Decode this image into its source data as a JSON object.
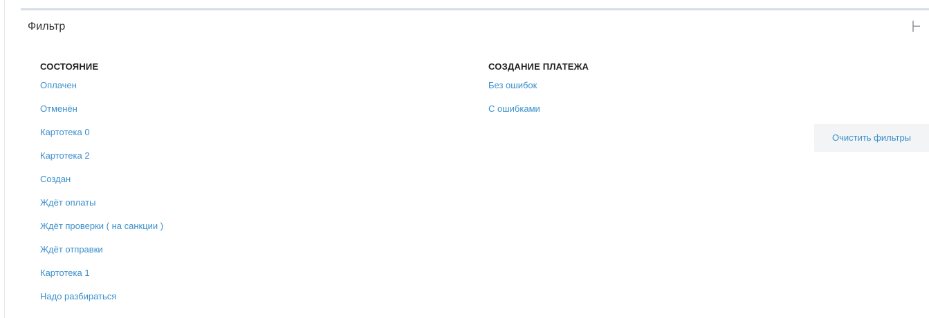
{
  "panel": {
    "title": "Фильтр",
    "collapse_icon": "collapse-bar-icon"
  },
  "groups": [
    {
      "title": "СОСТОЯНИЕ",
      "items": [
        "Оплачен",
        "Отменён",
        "Картотека 0",
        "Картотека 2",
        "Создан",
        "Ждёт оплаты",
        "Ждёт проверки ( на санкции )",
        "Ждёт отправки",
        "Картотека 1",
        "Надо разбираться"
      ]
    },
    {
      "title": "СОЗДАНИЕ ПЛАТЕЖА",
      "items": [
        "Без ошибок",
        "С ошибками"
      ]
    }
  ],
  "actions": {
    "clear_filters_label": "Очистить фильтры"
  },
  "colors": {
    "link": "#3a8fcb",
    "heading": "#222222",
    "panel_border": "#d6dde8",
    "button_bg": "#f3f4f6"
  }
}
